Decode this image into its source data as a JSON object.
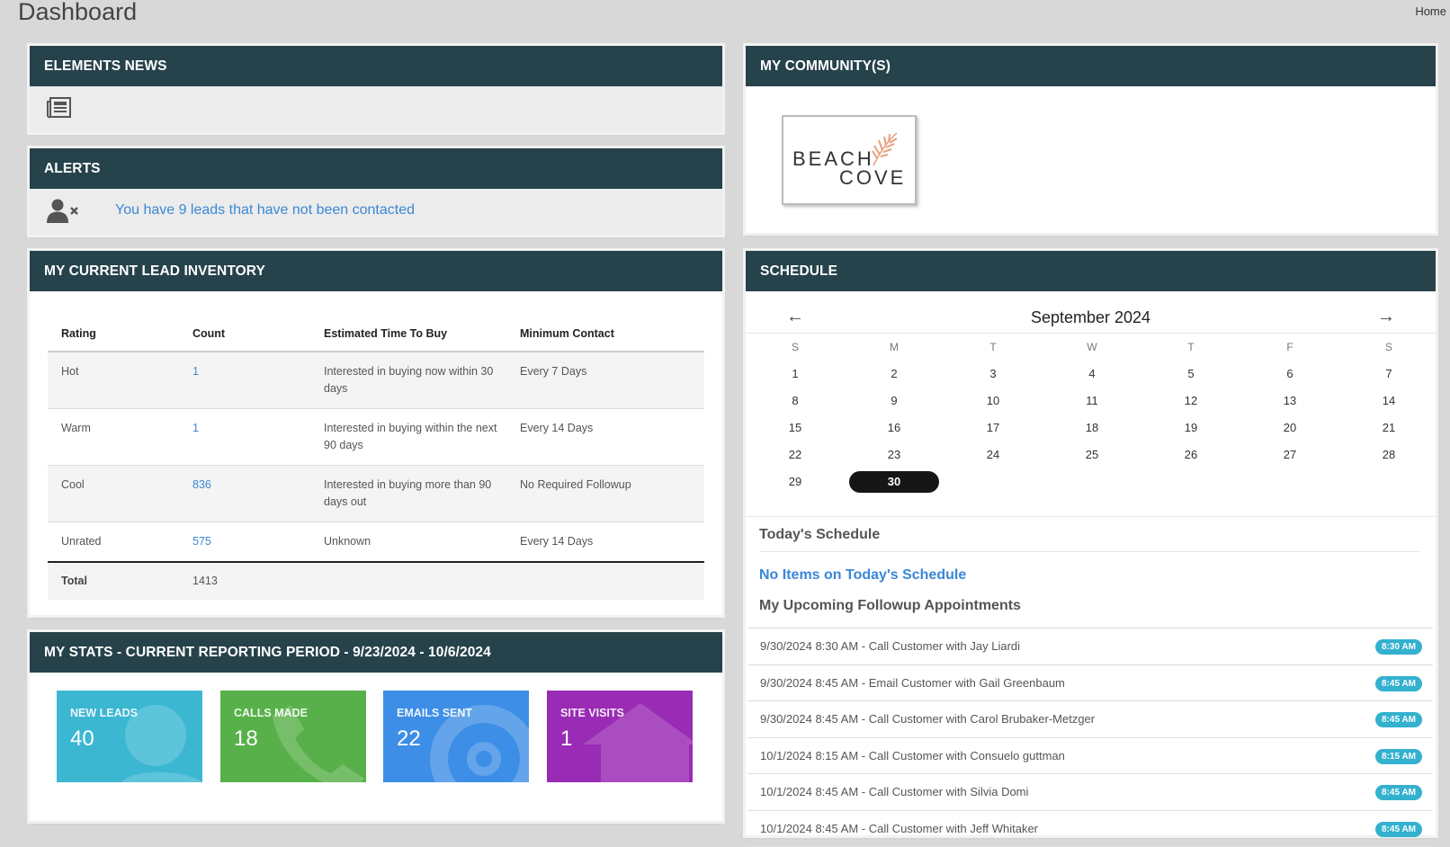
{
  "page": {
    "title": "Dashboard",
    "breadcrumb": "Home"
  },
  "news": {
    "title": "ELEMENTS NEWS",
    "icon": "newspaper-icon"
  },
  "alerts": {
    "title": "ALERTS",
    "icon": "user-times-icon",
    "message": "You have 9 leads that have not been contacted"
  },
  "inventory": {
    "title": "MY CURRENT LEAD INVENTORY",
    "columns": [
      "Rating",
      "Count",
      "Estimated Time To Buy",
      "Minimum Contact"
    ],
    "rows": [
      {
        "rating": "Hot",
        "count": "1",
        "time": "Interested in buying now within 30 days",
        "contact": "Every 7 Days"
      },
      {
        "rating": "Warm",
        "count": "1",
        "time": "Interested in buying within the next 90 days",
        "contact": "Every 14 Days"
      },
      {
        "rating": "Cool",
        "count": "836",
        "time": "Interested in buying more than 90 days out",
        "contact": "No Required Followup"
      },
      {
        "rating": "Unrated",
        "count": "575",
        "time": "Unknown",
        "contact": "Every 14 Days"
      }
    ],
    "total_label": "Total",
    "total_value": "1413"
  },
  "stats": {
    "title": "MY STATS - CURRENT REPORTING PERIOD - 9/23/2024 - 10/6/2024",
    "tiles": [
      {
        "label": "NEW LEADS",
        "value": "40",
        "color": "#3bb7d2",
        "icon": "user-icon"
      },
      {
        "label": "CALLS MADE",
        "value": "18",
        "color": "#58b04a",
        "icon": "phone-icon"
      },
      {
        "label": "EMAILS SENT",
        "value": "22",
        "color": "#3d8ee6",
        "icon": "at-icon"
      },
      {
        "label": "SITE VISITS",
        "value": "1",
        "color": "#9a2bb4",
        "icon": "home-icon"
      }
    ]
  },
  "community": {
    "title": "MY COMMUNITY(S)",
    "logo_line1": "BEACH",
    "logo_line2": "COVE"
  },
  "schedule": {
    "title": "SCHEDULE",
    "month": "September 2024",
    "prev": "←",
    "next": "→",
    "weekdays": [
      "S",
      "M",
      "T",
      "W",
      "T",
      "F",
      "S"
    ],
    "weeks": [
      [
        "1",
        "2",
        "3",
        "4",
        "5",
        "6",
        "7"
      ],
      [
        "8",
        "9",
        "10",
        "11",
        "12",
        "13",
        "14"
      ],
      [
        "15",
        "16",
        "17",
        "18",
        "19",
        "20",
        "21"
      ],
      [
        "22",
        "23",
        "24",
        "25",
        "26",
        "27",
        "28"
      ],
      [
        "29",
        "30",
        "",
        "",
        "",
        "",
        ""
      ]
    ],
    "today": "30",
    "todays_heading": "Today's Schedule",
    "no_items": "No Items on Today's Schedule",
    "upcoming_heading": "My Upcoming Followup Appointments",
    "appointments": [
      {
        "text": "9/30/2024 8:30 AM - Call Customer with Jay Liardi",
        "badge": "8:30 AM"
      },
      {
        "text": "9/30/2024 8:45 AM - Email Customer with Gail Greenbaum",
        "badge": "8:45 AM"
      },
      {
        "text": "9/30/2024 8:45 AM - Call Customer with Carol Brubaker-Metzger",
        "badge": "8:45 AM"
      },
      {
        "text": "10/1/2024 8:15 AM - Call Customer with Consuelo guttman",
        "badge": "8:15 AM"
      },
      {
        "text": "10/1/2024 8:45 AM - Call Customer with Silvia Domi",
        "badge": "8:45 AM"
      },
      {
        "text": "10/1/2024 8:45 AM - Call Customer with Jeff Whitaker",
        "badge": "8:45 AM"
      }
    ]
  }
}
